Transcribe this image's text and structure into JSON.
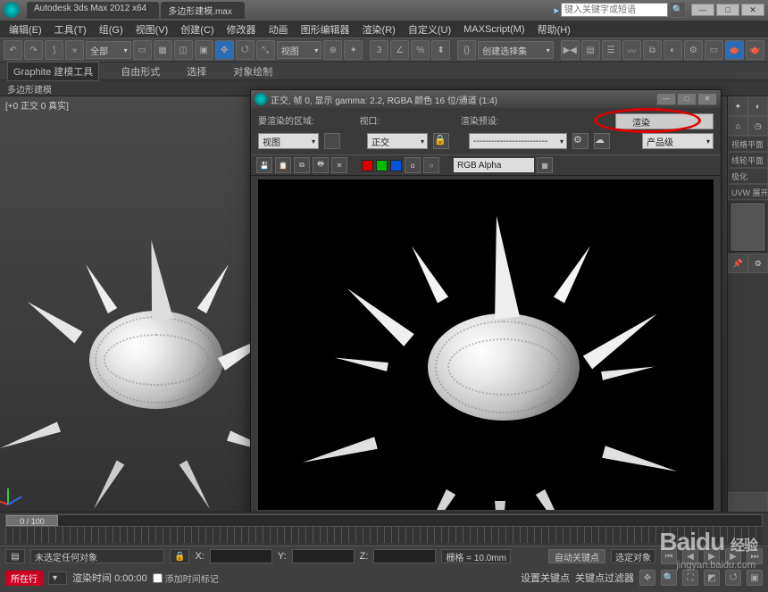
{
  "window": {
    "app_title": "Autodesk 3ds Max 2012 x64",
    "doc_title": "多边形建模.max",
    "search_placeholder": "键入关键字或短语"
  },
  "window_controls": {
    "min": "—",
    "max": "□",
    "close": "✕"
  },
  "menu": [
    "编辑(E)",
    "工具(T)",
    "组(G)",
    "视图(V)",
    "创建(C)",
    "修改器",
    "动画",
    "图形编辑器",
    "渲染(R)",
    "自定义(U)",
    "MAXScript(M)",
    "帮助(H)"
  ],
  "toolbar": {
    "selset_label": "全部",
    "view_label": "视图",
    "create_sel_label": "创建选择集"
  },
  "ribbon": {
    "tabs": [
      "Graphite 建模工具",
      "自由形式",
      "选择",
      "对象绘制"
    ],
    "sub": "多边形建模"
  },
  "viewport": {
    "label": "[+0 正交 0 真实]"
  },
  "render_window": {
    "title": "正交, 帧 0, 显示 gamma: 2.2, RGBA 颜色 16 位/通道 (1:4)",
    "labels": {
      "area": "要渲染的区域:",
      "viewport": "视口:",
      "preset": "渲染预设:"
    },
    "area_sel": "视图",
    "viewport_sel": "正交",
    "preset_sel": "-------------------------",
    "render_btn": "渲染",
    "product_sel": "产品级",
    "channel_sel": "RGB Alpha",
    "swatches": [
      "#d00",
      "#0b0",
      "#05d"
    ]
  },
  "cmdpanel": {
    "items": [
      "视格平面",
      "线轮平面",
      "极化",
      "UVW 展开"
    ]
  },
  "timeline": {
    "pos": "0 / 100"
  },
  "status": {
    "sel_label": "未选定任何对象",
    "grid_label": "栅格 = 10.0mm",
    "autokey": "自动关键点",
    "selfilter": "选定对象",
    "setkey": "设置关键点",
    "keyfilter": "关键点过滤器",
    "x": "X:",
    "y": "Y:",
    "z": "Z:",
    "run_tag": "所在行",
    "addtime_label": "添加时间标记",
    "time_label": "渲染时间 0:00:00"
  },
  "watermark": {
    "brand": "Baidu",
    "sub": "经验",
    "url": "jingyan.baidu.com"
  }
}
